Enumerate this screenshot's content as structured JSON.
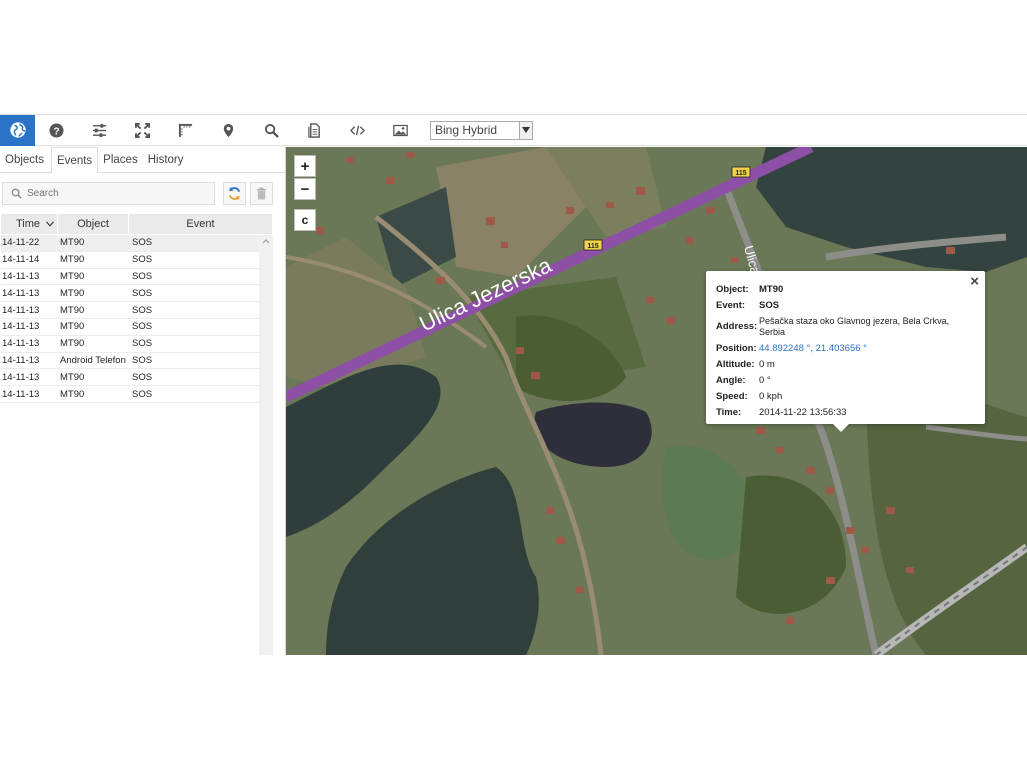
{
  "toolbar": {
    "buttons": [
      {
        "icon": "globe-icon"
      },
      {
        "icon": "help-icon"
      },
      {
        "icon": "settings-sliders-icon"
      },
      {
        "icon": "fullscreen-icon"
      },
      {
        "icon": "ruler-icon"
      },
      {
        "icon": "map-marker-icon"
      },
      {
        "icon": "search-icon"
      },
      {
        "icon": "document-icon"
      },
      {
        "icon": "code-icon"
      },
      {
        "icon": "image-icon"
      }
    ],
    "map_type": "Bing Hybrid",
    "accent_color": "#2a73c6"
  },
  "tabs": [
    "Objects",
    "Events",
    "Places",
    "History"
  ],
  "active_tab": "Events",
  "search": {
    "placeholder": "Search"
  },
  "table": {
    "headers": {
      "time": "Time",
      "object": "Object",
      "event": "Event"
    },
    "rows": [
      {
        "time": "14-11-22",
        "object": "MT90",
        "event": "SOS"
      },
      {
        "time": "14-11-14",
        "object": "MT90",
        "event": "SOS"
      },
      {
        "time": "14-11-13",
        "object": "MT90",
        "event": "SOS"
      },
      {
        "time": "14-11-13",
        "object": "MT90",
        "event": "SOS"
      },
      {
        "time": "14-11-13",
        "object": "MT90",
        "event": "SOS"
      },
      {
        "time": "14-11-13",
        "object": "MT90",
        "event": "SOS"
      },
      {
        "time": "14-11-13",
        "object": "MT90",
        "event": "SOS"
      },
      {
        "time": "14-11-13",
        "object": "Android Telefon",
        "event": "SOS"
      },
      {
        "time": "14-11-13",
        "object": "MT90",
        "event": "SOS"
      },
      {
        "time": "14-11-13",
        "object": "MT90",
        "event": "SOS"
      }
    ]
  },
  "map": {
    "zoom_in": "+",
    "zoom_out": "−",
    "center_button": "c",
    "street_label": "Ulica Jezerska",
    "street_label_2": "Ulica",
    "route_shield_1": "115",
    "route_shield_2": "115",
    "road_color": "#8e4fa6"
  },
  "popup": {
    "close": "×",
    "object_label": "Object:",
    "object": "MT90",
    "event_label": "Event:",
    "event": "SOS",
    "address_label": "Address:",
    "address": "Pešačka staza oko Glavnog jezera, Bela Crkva, Serbia",
    "position_label": "Position:",
    "position": "44.892248 °, 21.403656 °",
    "altitude_label": "Altitude:",
    "altitude": "0 m",
    "angle_label": "Angle:",
    "angle": "0 °",
    "speed_label": "Speed:",
    "speed": "0 kph",
    "time_label": "Time:",
    "time": "2014-11-22 13:56:33"
  }
}
